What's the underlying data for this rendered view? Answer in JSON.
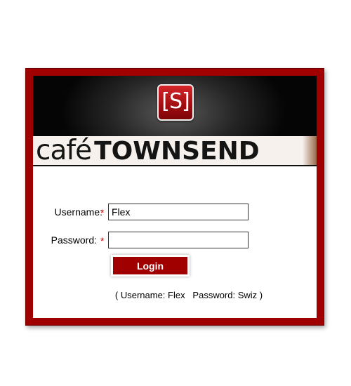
{
  "banner": {
    "logo_mark": "[S]",
    "brand_cafe": "café",
    "brand_name": "TOWNSEND"
  },
  "form": {
    "username_label": "Username:",
    "password_label": "Password:",
    "required_marker": "*",
    "username_value": "Flex",
    "password_value": "",
    "login_label": "Login",
    "hint": "( Username: Flex   Password: Swiz )"
  },
  "colors": {
    "frame": "#a00000",
    "button": "#a00000",
    "required": "#d40000"
  }
}
